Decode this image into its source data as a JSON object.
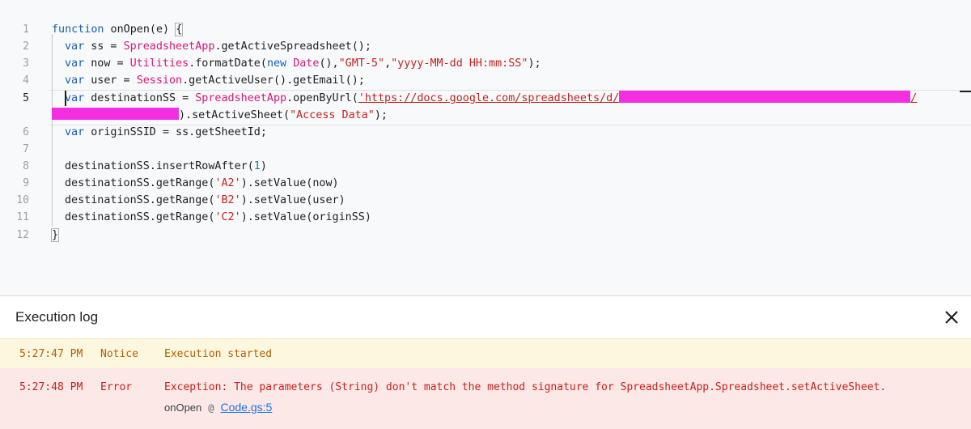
{
  "editor": {
    "line_numbers": [
      "1",
      "2",
      "3",
      "4",
      "5",
      "6",
      "7",
      "8",
      "9",
      "10",
      "11",
      "12"
    ],
    "active_line": "5",
    "lines": {
      "l1": {
        "kw": "function",
        "rest": " onOpen(e) ",
        "brace": "{"
      },
      "l2": {
        "kw": "var",
        "a": " ss = ",
        "cls": "SpreadsheetApp",
        "b": ".getActiveSpreadsheet();"
      },
      "l3": {
        "kw": "var",
        "a": " now = ",
        "cls": "Utilities",
        "b": ".formatDate(",
        "kw2": "new",
        "c": " ",
        "cls2": "Date",
        "d": "(),",
        "s1": "\"GMT-5\"",
        "e": ",",
        "s2": "\"yyyy-MM-dd HH:mm:SS\"",
        "f": ");"
      },
      "l4": {
        "kw": "var",
        "a": " user = ",
        "cls": "Session",
        "b": ".getActiveUser().getEmail();"
      },
      "l5": {
        "kw": "var",
        "a": " destinationSS = ",
        "cls": "SpreadsheetApp",
        "b": ".openByUrl(",
        "s1": "'https://docs.google.com/spreadsheets/d/",
        "s2": "/"
      },
      "l5b": {
        "a": ").setActiveSheet(",
        "s1": "\"Access Data\"",
        "b": ");"
      },
      "l6": {
        "kw": "var",
        "a": " originSSID = ss.getSheetId;"
      },
      "l8": {
        "a": "destinationSS.insertRowAfter(",
        "num": "1",
        "b": ")"
      },
      "l9": {
        "a": "destinationSS.getRange(",
        "s1": "'A2'",
        "b": ").setValue(now)"
      },
      "l10": {
        "a": "destinationSS.getRange(",
        "s1": "'B2'",
        "b": ").setValue(user)"
      },
      "l11": {
        "a": "destinationSS.getRange(",
        "s1": "'C2'",
        "b": ").setValue(originSS)"
      },
      "l12": {
        "brace": "}"
      }
    }
  },
  "log": {
    "title": "Execution log",
    "close_icon": "close-icon",
    "entries": [
      {
        "time": "5:27:47 PM",
        "severity": "Notice",
        "message": "Execution started"
      },
      {
        "time": "5:27:48 PM",
        "severity": "Error",
        "message": "Exception: The parameters (String) don't match the method signature for SpreadsheetApp.Spreadsheet.setActiveSheet.",
        "function": "onOpen",
        "at": "@",
        "location": "Code.gs:5"
      }
    ]
  },
  "colors": {
    "keyword": "#1a5fb4",
    "class": "#d6177a",
    "string": "#c5221f",
    "redaction": "#f42fe1",
    "notice_bg": "#fef7e0",
    "error_bg": "#fce8e6",
    "link": "#1a73e8"
  }
}
